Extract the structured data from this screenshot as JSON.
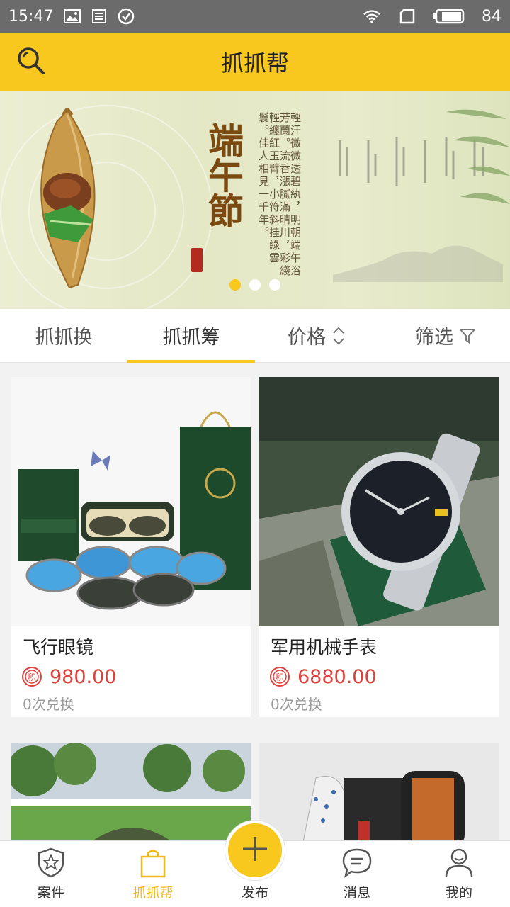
{
  "status_bar": {
    "time": "15:47",
    "battery": "84"
  },
  "header": {
    "title": "抓抓帮"
  },
  "banner": {
    "title": "端午節",
    "poem": "輕汗微微透碧紈，明朝端午浴芳蘭。流香漲膩滿晴川，彩綫輕纏紅玉臂，小符斜挂綠雲鬟。佳人相見一千年。",
    "slides": 3,
    "active_slide": 0
  },
  "tabs": [
    {
      "label": "抓抓换"
    },
    {
      "label": "抓抓筹"
    },
    {
      "label": "价格"
    },
    {
      "label": "筛选"
    }
  ],
  "products": [
    {
      "name": "飞行眼镜",
      "price": "980.00",
      "exchanges": "0次兑换"
    },
    {
      "name": "军用机械手表",
      "price": "6880.00",
      "exchanges": "0次兑换"
    }
  ],
  "bottom_nav": [
    {
      "label": "案件",
      "icon": "shield-star-icon"
    },
    {
      "label": "抓抓帮",
      "icon": "shopping-bag-icon"
    },
    {
      "label": "发布",
      "icon": "plus-icon"
    },
    {
      "label": "消息",
      "icon": "chat-bubble-icon"
    },
    {
      "label": "我的",
      "icon": "person-icon"
    }
  ],
  "colors": {
    "accent": "#f8c81e",
    "price": "#e0413c",
    "statusbar": "#6b6b6b"
  }
}
